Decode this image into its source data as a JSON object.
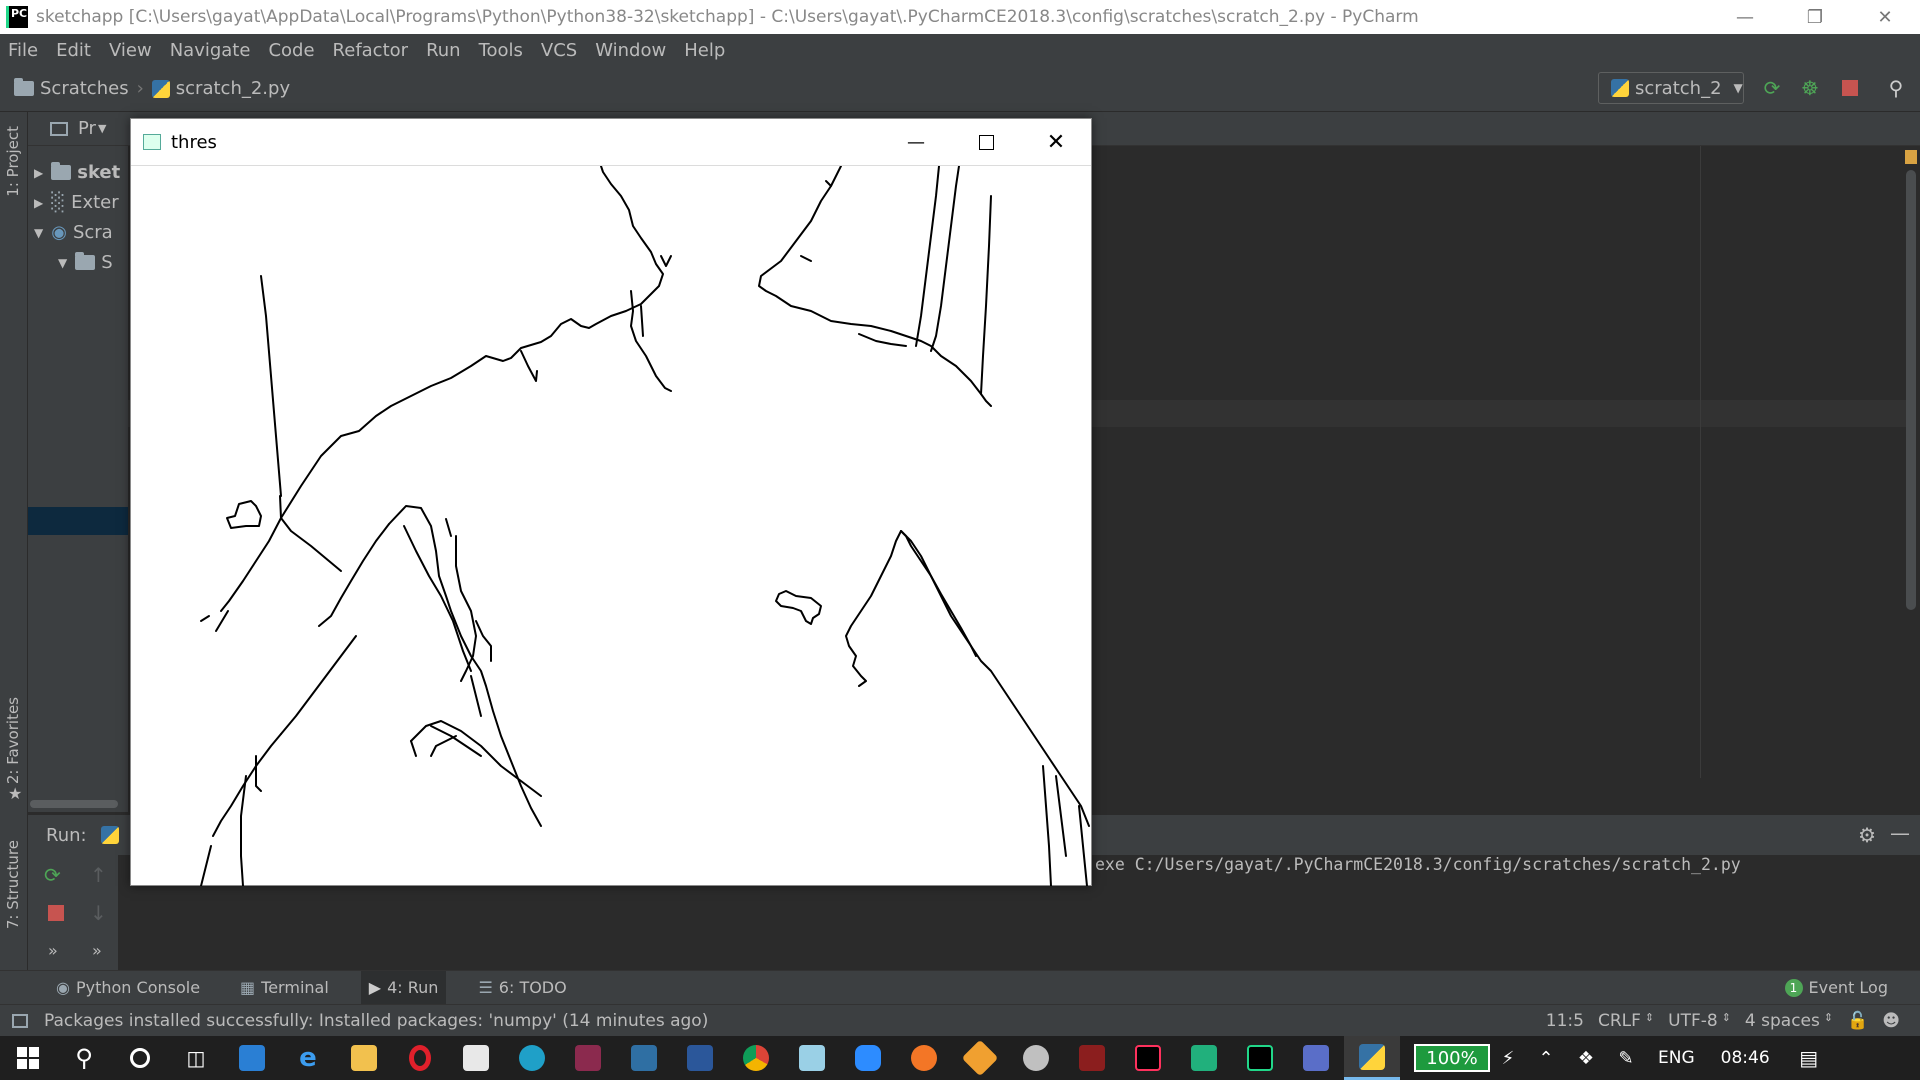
{
  "window": {
    "title": "sketchapp [C:\\Users\\gayat\\AppData\\Local\\Programs\\Python\\Python38-32\\sketchapp] - C:\\Users\\gayat\\.PyCharmCE2018.3\\config\\scratches\\scratch_2.py - PyCharm",
    "logo_text": "PC"
  },
  "menu": [
    "File",
    "Edit",
    "View",
    "Navigate",
    "Code",
    "Refactor",
    "Run",
    "Tools",
    "VCS",
    "Window",
    "Help"
  ],
  "breadcrumb": {
    "root": "Scratches",
    "file": "scratch_2.py"
  },
  "run_config": {
    "name": "scratch_2"
  },
  "left_strip": {
    "project": "1: Project",
    "favorites": "2: Favorites",
    "structure": "7: Structure"
  },
  "project_panel": {
    "header": "Pr",
    "items": [
      {
        "label": "sket"
      },
      {
        "label": "Exter"
      },
      {
        "label": "Scra"
      },
      {
        "label": "S"
      }
    ]
  },
  "run_panel": {
    "label": "Run:",
    "console_line": "exe C:/Users/gayat/.PyCharmCE2018.3/config/scratches/scratch_2.py"
  },
  "tool_tabs": [
    {
      "label": "Python Console"
    },
    {
      "label": "Terminal"
    },
    {
      "label": "4: Run"
    },
    {
      "label": "6: TODO"
    }
  ],
  "event_log": {
    "label": "Event Log",
    "count": "1"
  },
  "status": {
    "message": "Packages installed successfully: Installed packages: 'numpy' (14 minutes ago)",
    "position": "11:5",
    "line_sep": "CRLF",
    "encoding": "UTF-8",
    "indent": "4 spaces"
  },
  "thres_window": {
    "title": "thres"
  },
  "taskbar": {
    "battery": "100%",
    "lang": "ENG",
    "time": "08:46"
  },
  "colors": {
    "ide_bg": "#2b2b2b",
    "panel_bg": "#3c3f41",
    "run_green": "#4ea556",
    "stop_red": "#c75450",
    "taskbar_bg": "#1f1f1f"
  }
}
